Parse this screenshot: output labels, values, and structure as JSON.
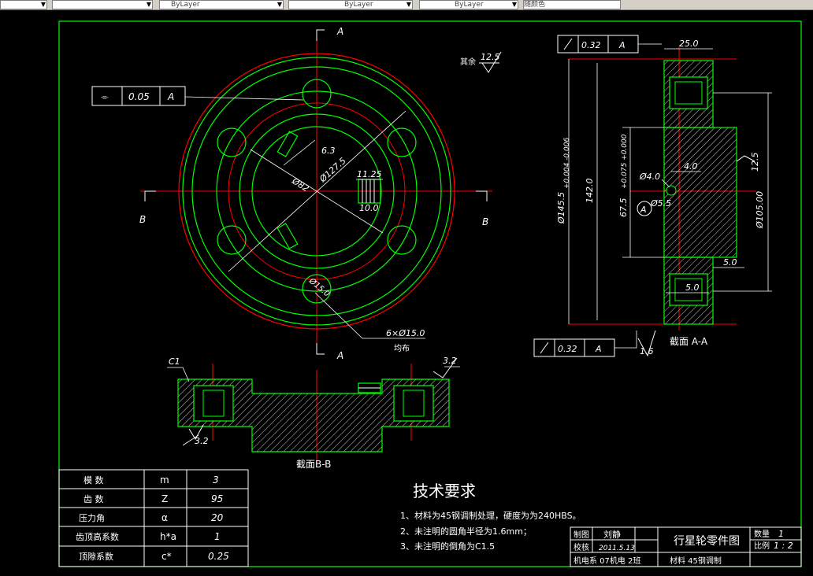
{
  "toolbar": {
    "box1": "",
    "box2": "",
    "box3": "ByLayer",
    "box4": "ByLayer",
    "box5": "ByLayer",
    "box6": "随颜色"
  },
  "front_view": {
    "datum_top": "A",
    "datum_bottom": "A",
    "section_left": "B",
    "section_right": "B",
    "flatness_sym": "⌯",
    "flatness_val": "0.05",
    "flatness_datum": "A",
    "dim_63": "6.3",
    "dim_1275": "Ø127.5",
    "dim_82": "Ø82",
    "dim_1125": "11.25",
    "dim_100": "10.0",
    "dim_150": "Ø15.0",
    "holes": "6×Ø15.0",
    "holes_note": "均布",
    "rest_label": "其余",
    "rest_val": "12.5"
  },
  "side_view": {
    "tol1_val": "0.32",
    "tol1_datum": "A",
    "dim_250": "25.0",
    "dim_1455": "Ø145.5",
    "dim_1455_tol": "+0.004 -0.006",
    "dim_1420": "142.0",
    "dim_675": "67.5",
    "dim_675_tol": "+0.075 +0.000",
    "dim_40a": "Ø4.0",
    "dim_40b": "4.0",
    "dim_55": "Ø5.5",
    "datum_a": "A",
    "dim_1050": "Ø105.00",
    "rough_125": "12.5",
    "dim_50a": "5.0",
    "dim_50b": "5.0",
    "tol2_val": "0.32",
    "tol2_datum": "A",
    "rough_16": "1.6",
    "section_title": "截面 A-A"
  },
  "section_bb": {
    "c1": "C1",
    "rough_32a": "3.2",
    "rough_32b": "3.2",
    "title": "截面B-B"
  },
  "params": {
    "rows": [
      {
        "name": "模  数",
        "sym": "m",
        "val": "3"
      },
      {
        "name": "齿  数",
        "sym": "Z",
        "val": "95"
      },
      {
        "name": "压力角",
        "sym": "α",
        "val": "20"
      },
      {
        "name": "齿顶高系数",
        "sym": "h*a",
        "val": "1"
      },
      {
        "name": "顶隙系数",
        "sym": "c*",
        "val": "0.25"
      }
    ]
  },
  "tech": {
    "title": "技术要求",
    "line1": "1、材料为45钢调制处理，硬度为为240HBS。",
    "line2": "2、未注明的圆角半径为1.6mm；",
    "line3": "3、未注明的倒角为C1.5"
  },
  "titleblock": {
    "draw_label": "制图",
    "draw_name": "刘静",
    "check_label": "校核",
    "check_date": "2011.5.13",
    "dept": "机电系 07机电 2班",
    "part_name": "行星轮零件图",
    "material": "材料 45钢调制",
    "qty_label": "数量",
    "qty_val": "1",
    "scale_label": "比例",
    "scale_val": "1 : 2"
  }
}
